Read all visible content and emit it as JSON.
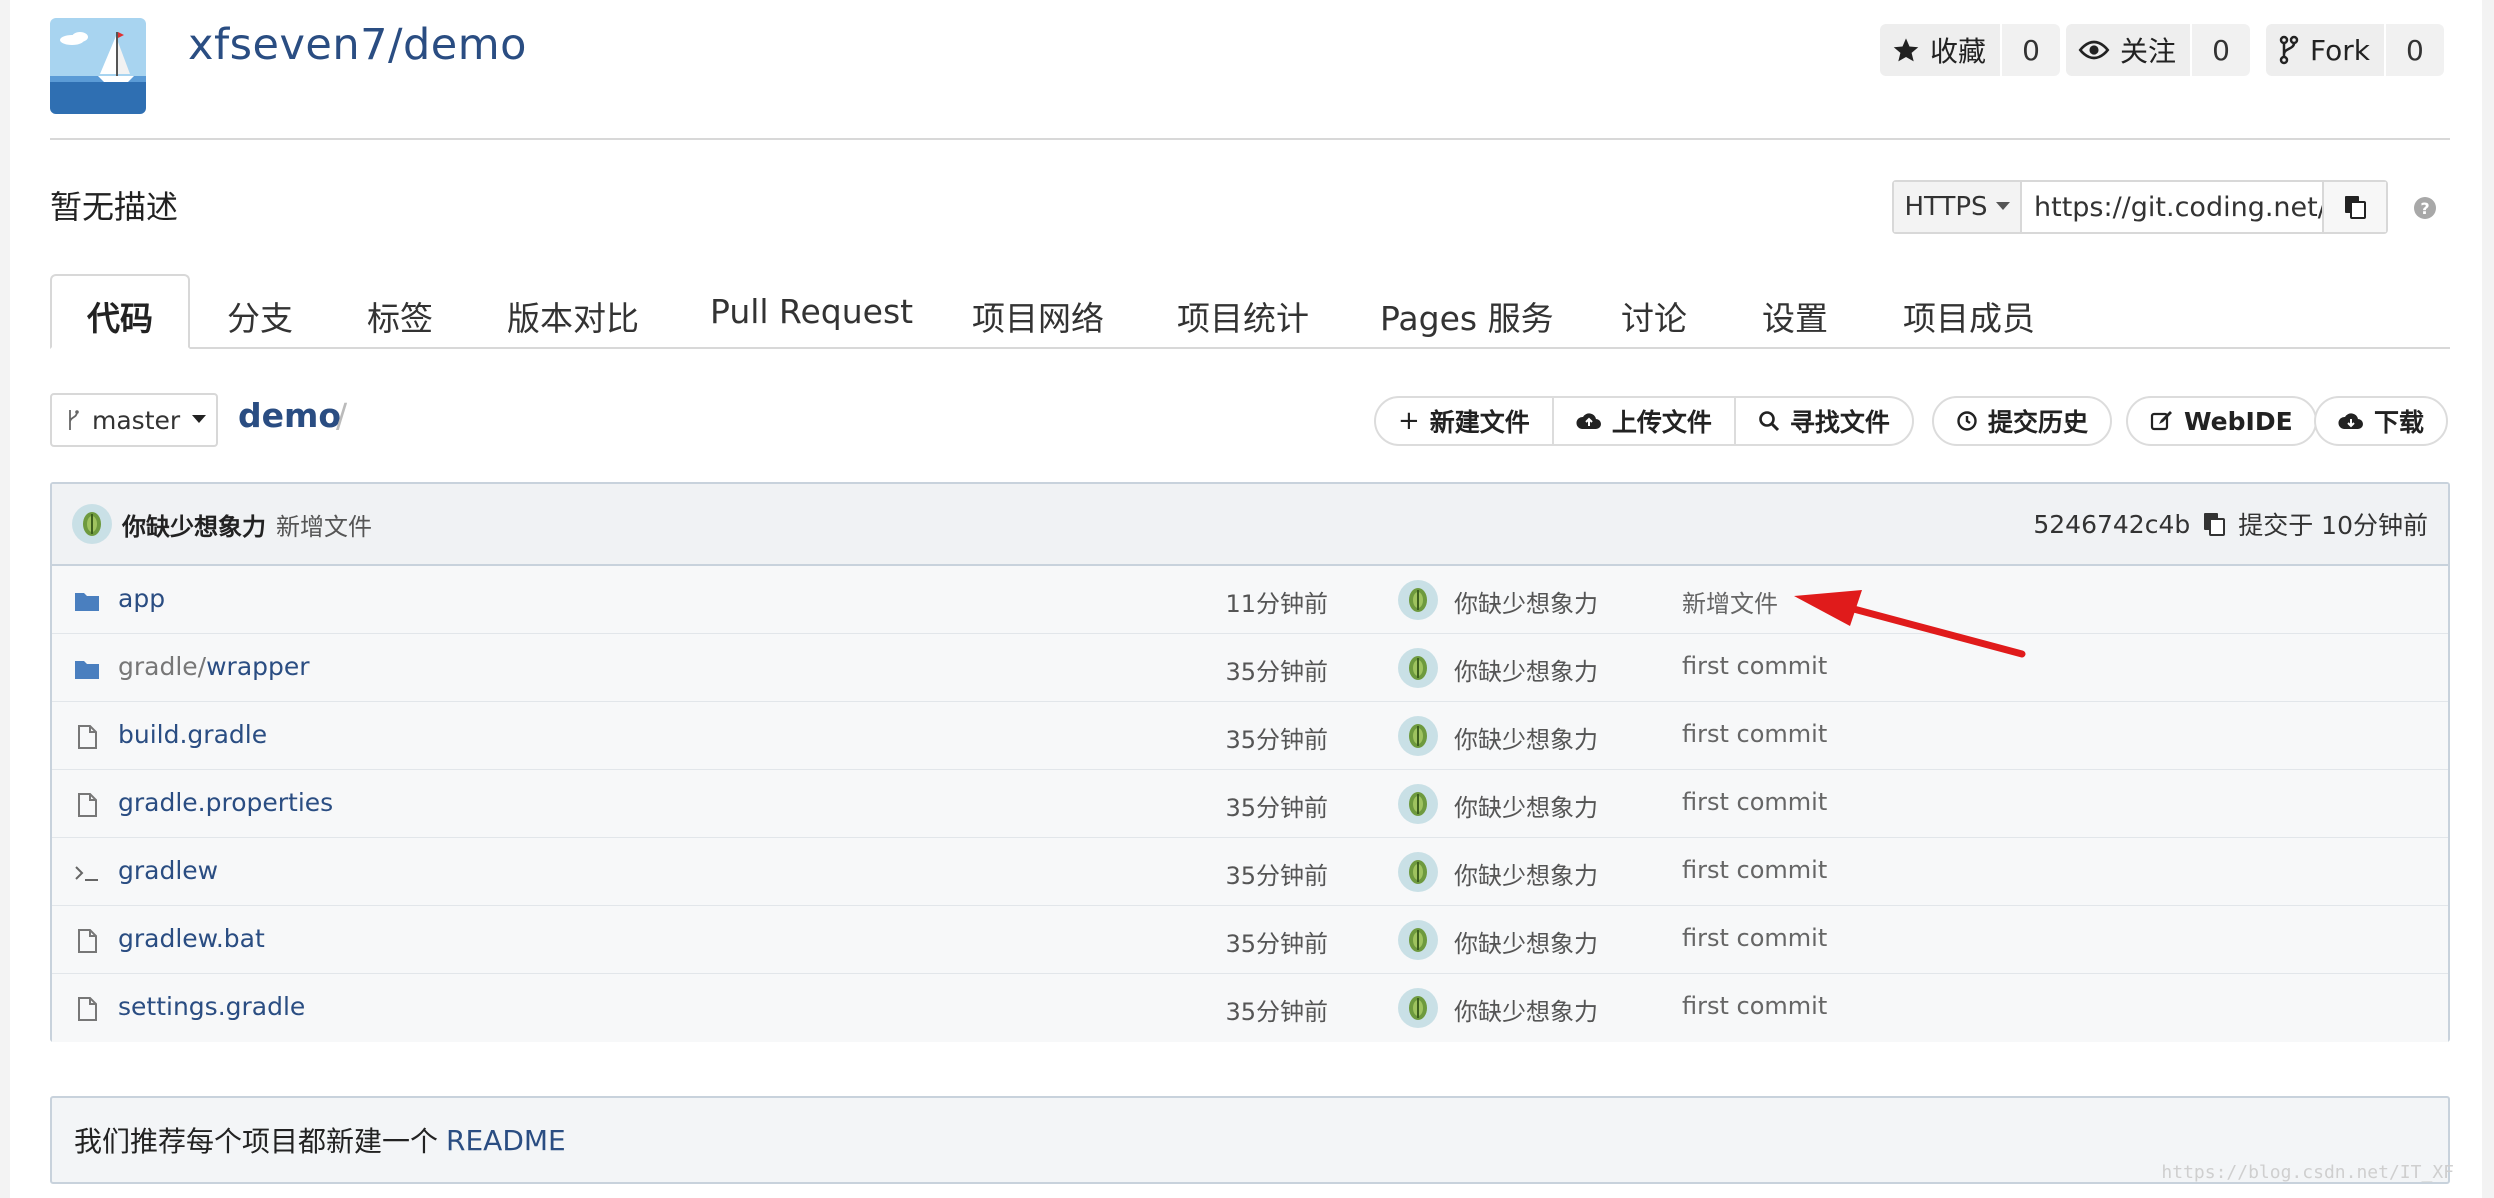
{
  "header": {
    "repo_name": "xfseven7/demo",
    "stats": [
      {
        "label": "收藏",
        "count": "0",
        "icon": "star-icon"
      },
      {
        "label": "关注",
        "count": "0",
        "icon": "eye-icon"
      },
      {
        "label": "Fork",
        "count": "0",
        "icon": "fork-icon"
      }
    ]
  },
  "description": "暂无描述",
  "clone": {
    "protocol": "HTTPS",
    "url": "https://git.coding.net/",
    "help": "?"
  },
  "tabs": [
    "代码",
    "分支",
    "标签",
    "版本对比",
    "Pull Request",
    "项目网络",
    "项目统计",
    "Pages 服务",
    "讨论",
    "设置",
    "项目成员"
  ],
  "branch": {
    "name": "master",
    "path_root": "demo",
    "path_sep": "/"
  },
  "actions": {
    "new_file": "新建文件",
    "upload_file": "上传文件",
    "find_file": "寻找文件",
    "history": "提交历史",
    "webide": "WebIDE",
    "download": "下载"
  },
  "latest_commit": {
    "author": "你缺少想象力",
    "message": "新增文件",
    "hash": "5246742c4b",
    "time": "提交于 10分钟前"
  },
  "files": [
    {
      "name": "app",
      "prefix": "",
      "type": "folder",
      "time": "11分钟前",
      "author": "你缺少想象力",
      "commit": "新增文件"
    },
    {
      "name": "wrapper",
      "prefix": "gradle/",
      "type": "folder",
      "time": "35分钟前",
      "author": "你缺少想象力",
      "commit": "first commit"
    },
    {
      "name": "build.gradle",
      "prefix": "",
      "type": "file",
      "time": "35分钟前",
      "author": "你缺少想象力",
      "commit": "first commit"
    },
    {
      "name": "gradle.properties",
      "prefix": "",
      "type": "file",
      "time": "35分钟前",
      "author": "你缺少想象力",
      "commit": "first commit"
    },
    {
      "name": "gradlew",
      "prefix": "",
      "type": "terminal",
      "time": "35分钟前",
      "author": "你缺少想象力",
      "commit": "first commit"
    },
    {
      "name": "gradlew.bat",
      "prefix": "",
      "type": "file",
      "time": "35分钟前",
      "author": "你缺少想象力",
      "commit": "first commit"
    },
    {
      "name": "settings.gradle",
      "prefix": "",
      "type": "file",
      "time": "35分钟前",
      "author": "你缺少想象力",
      "commit": "first commit"
    }
  ],
  "readme": {
    "text": "我们推荐每个项目都新建一个",
    "link": "README"
  },
  "watermark": "https://blog.csdn.net/IT_XF",
  "colors": {
    "link": "#2a4d82",
    "arrow": "#e01b1b",
    "folder": "#4a7fbf"
  }
}
